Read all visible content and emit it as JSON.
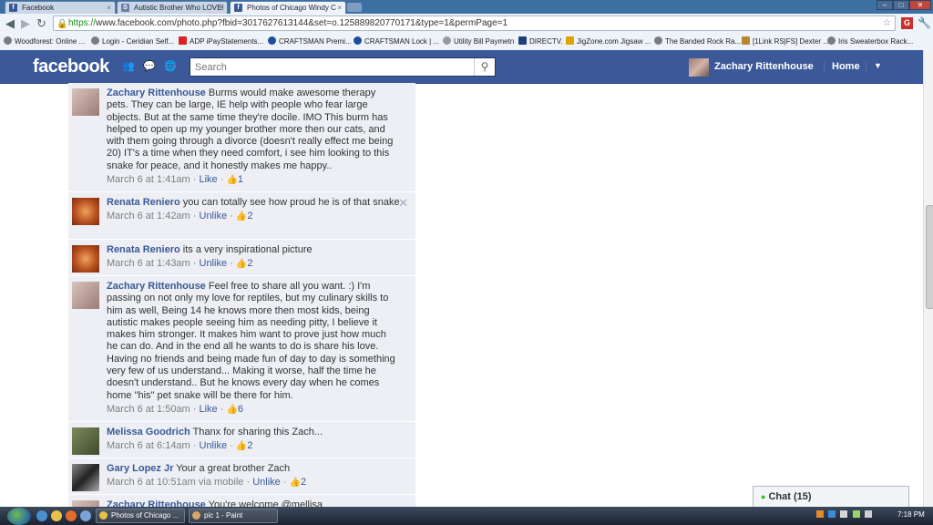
{
  "browser": {
    "tabs": [
      {
        "title": "Facebook",
        "active": false
      },
      {
        "title": "Autistic Brother Who LOVE!",
        "active": false
      },
      {
        "title": "Photos of Chicago Windy C",
        "active": true
      }
    ],
    "url_scheme": "https://",
    "url_rest": "www.facebook.com/photo.php?fbid=3017627613144&set=o.125889820770171&type=1&permPage=1",
    "bookmarks": [
      "Woodforest: Online ...",
      "Login - Ceridian Self...",
      "ADP iPayStatements...",
      "CRAFTSMAN Premi...",
      "CRAFTSMAN Lock | ...",
      "Utility Bill Paymetn",
      "DIRECTV.",
      "JigZone.com Jigsaw ...",
      "The Banded Rock Ra...",
      "[1Link RS|FS] Dexter ...",
      "Iris Sweaterbox Rack..."
    ]
  },
  "facebook": {
    "logo": "facebook",
    "search_placeholder": "Search",
    "user_name": "Zachary Rittenhouse",
    "home_label": "Home"
  },
  "comments": [
    {
      "author": "Zachary Rittenhouse",
      "text": "Burms would make awesome therapy pets. They can be large, IE help with people who fear large objects. But at the same time they're docile. IMO This burm has helped to open up my younger brother more then our cats, and with them going through a divorce (doesn't really effect me being 20) IT's a time when they need comfort, i see him looking to this snake for peace, and it honestly makes me happy..",
      "time": "March 6 at 1:41am",
      "action": "Like",
      "likes": "1",
      "avatar_color": "#b89a96"
    },
    {
      "author": "Renata Reniero",
      "text": "you can totally see how proud he is of that snake",
      "time": "March 6 at 1:42am",
      "action": "Unlike",
      "likes": "2",
      "avatar_color": "#c8612e"
    },
    {
      "author": "Renata Reniero",
      "text": "its a very inspirational picture",
      "time": "March 6 at 1:43am",
      "action": "Unlike",
      "likes": "2",
      "avatar_color": "#c8612e"
    },
    {
      "author": "Zachary Rittenhouse",
      "text": "Feel free to share all you want. :) I'm passing on not only my love for reptiles, but my culinary skills to him as well, Being 14 he knows more then most kids, being autistic makes people seeing him as needing pitty, I believe it makes him stronger. It makes him want to prove just how much he can do. And in the end all he wants to do is share his love. Having no friends and being made fun of day to day is something very few of us understand... Making it worse, half the time he doesn't understand.. But he knows every day when he comes home \"his\" pet snake will be there for him.",
      "time": "March 6 at 1:50am",
      "action": "Like",
      "likes": "6",
      "avatar_color": "#b89a96"
    },
    {
      "author": "Melissa Goodrich",
      "text": "Thanx for sharing this Zach...",
      "time": "March 6 at 6:14am",
      "action": "Unlike",
      "likes": "2",
      "avatar_color": "#5f6b4a"
    },
    {
      "author": "Gary Lopez Jr",
      "text": "Your a great brother Zach",
      "time": "March 6 at 10:51am via mobile",
      "action": "Unlike",
      "likes": "2",
      "avatar_color": "#3f3f3f"
    },
    {
      "author": "Zachary Rittenhouse",
      "text": "You're welcome @mellisa",
      "time": "",
      "action": "",
      "likes": "",
      "avatar_color": "#b89a96"
    }
  ],
  "chat": {
    "label": "Chat",
    "count": "(15)"
  },
  "taskbar": {
    "tasks": [
      "Photos of Chicago ...",
      "pic 1 - Paint"
    ],
    "clock": "7:18 PM"
  }
}
